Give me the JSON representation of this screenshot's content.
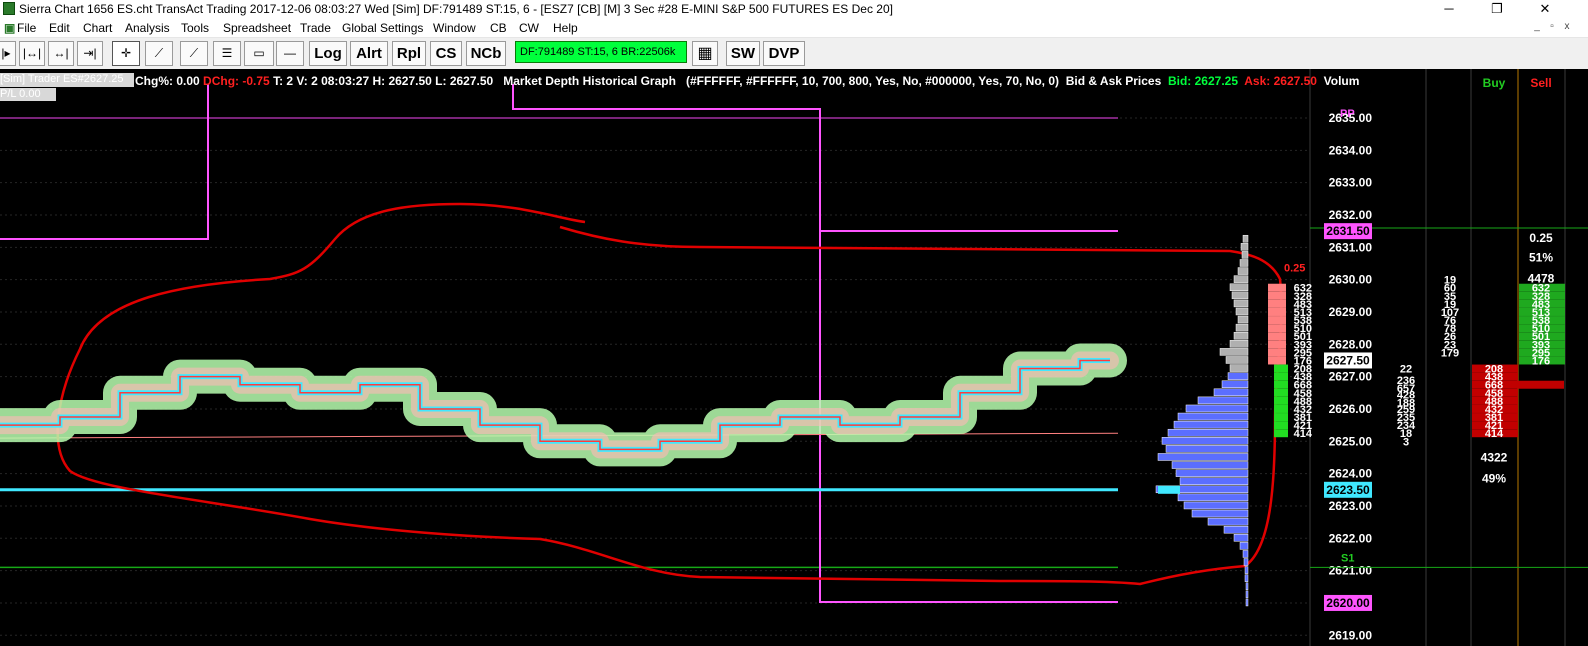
{
  "window": {
    "title": "Sierra Chart 1656 ES.cht  TransAct Trading 2017-12-06  08:03:27 Wed [Sim]  DF:791489  ST:15, 6 - [ESZ7 [CB] [M]  3 Sec   #28  E-MINI S&P 500 FUTURES ES Dec 20]",
    "minimize": "─",
    "restore": "❐",
    "close": "✕"
  },
  "menu": {
    "items": [
      "File",
      "Edit",
      "Chart",
      "Analysis",
      "Tools",
      "Spreadsheet",
      "Trade",
      "Global Settings",
      "Window",
      "CB",
      "CW",
      "Help"
    ],
    "mdi_min": "_",
    "mdi_restore": "▫",
    "mdi_close": "x"
  },
  "toolbar": {
    "icon_glyphs": [
      "|▸",
      "|↔|",
      "↔|",
      "⇥|",
      "✛",
      "⟋",
      "⟋",
      "☰",
      "▭",
      "—"
    ],
    "log": "Log",
    "alrt": "Alrt",
    "rpl": "Rpl",
    "cs": "CS",
    "ncb": "NCb",
    "df_status": "DF:791489  ST:15, 6  BR:22506k",
    "time_icon": "▦",
    "sw": "SW",
    "dvp": "DVP"
  },
  "colors": {
    "pp_line": "#7a247a",
    "s1_line": "#17a817",
    "magenta": "#ff55ff",
    "red_curve": "#e00000",
    "cyan": "#40e8ff",
    "blue_vap": "#5b6eff",
    "buy_green": "#1fa91f",
    "sell_red": "#c10000"
  },
  "info_bar": {
    "sim_label": "[Sim]  Trader  ES#2627.25",
    "pl_label": "P/L 0.00",
    "chg": "Chg%: 0.00",
    "dchg": "DChg: -0.75",
    "stats": "T: 2  V: 2  08:03:27  H: 2627.50  L: 2627.50",
    "mdhg": "Market Depth Historical Graph",
    "params": "(#FFFFFF, #FFFFFF, 10, 700, 800, Yes, No, #000000, Yes, 70, No, 0)",
    "bidask": "Bid & Ask Prices",
    "bid": "Bid: 2627.25",
    "ask": "Ask: 2627.50",
    "volume": "Volum"
  },
  "chart_data": {
    "type": "line",
    "price_axis": {
      "min": 2619.5,
      "max": 2635.5,
      "ticks": [
        "2635.00",
        "2634.00",
        "2633.00",
        "2632.00",
        "2631.00",
        "2630.00",
        "2629.00",
        "2628.00",
        "2627.00",
        "2626.00",
        "2625.00",
        "2624.00",
        "2623.00",
        "2622.00",
        "2621.00",
        "2620.00",
        "2619.00"
      ]
    },
    "levels": [
      {
        "label": "PP",
        "price": 2635.0
      },
      {
        "label": "S1",
        "price": 2621.1
      },
      {
        "label": "2631.50",
        "price": 2631.5
      },
      {
        "label": "2623.50",
        "price": 2623.5
      },
      {
        "label": "2620.00",
        "price": 2620.0
      }
    ],
    "last_price": "2627.50",
    "ask_ladder_value": "0.25",
    "ladder_ask_sizes": [
      "632",
      "328",
      "483",
      "513",
      "538",
      "510",
      "501",
      "393",
      "295",
      "176"
    ],
    "ladder_bid_sizes": [
      "208",
      "438",
      "668",
      "458",
      "488",
      "432",
      "381",
      "421",
      "414"
    ],
    "col_a": [
      {
        "price": 2627.25,
        "v": "22"
      },
      {
        "price": 2626.9,
        "v": "236"
      },
      {
        "price": 2626.65,
        "v": "657"
      },
      {
        "price": 2626.45,
        "v": "428"
      },
      {
        "price": 2626.2,
        "v": "188"
      },
      {
        "price": 2626.0,
        "v": "259"
      },
      {
        "price": 2625.75,
        "v": "235"
      },
      {
        "price": 2625.5,
        "v": "234"
      },
      {
        "price": 2625.25,
        "v": "18"
      },
      {
        "price": 2625.0,
        "v": "3"
      }
    ],
    "col_b": [
      {
        "price": 2630.0,
        "v": "19"
      },
      {
        "price": 2629.75,
        "v": "60"
      },
      {
        "price": 2629.5,
        "v": "35"
      },
      {
        "price": 2629.25,
        "v": "19"
      },
      {
        "price": 2629.0,
        "v": "107"
      },
      {
        "price": 2628.75,
        "v": "76"
      },
      {
        "price": 2628.5,
        "v": "78"
      },
      {
        "price": 2628.25,
        "v": "26"
      },
      {
        "price": 2628.0,
        "v": "23"
      },
      {
        "price": 2627.75,
        "v": "179"
      }
    ],
    "buy_header": "Buy",
    "sell_header": "Sell",
    "sell_tick": "0.25",
    "sell_pct": "51%",
    "sell_total": "4478",
    "buy_total": "4322",
    "buy_pct": "49%",
    "sell_sizes": [
      "632",
      "328",
      "483",
      "513",
      "538",
      "510",
      "501",
      "393",
      "295",
      "176"
    ],
    "buy_sizes": [
      "208",
      "438",
      "668",
      "458",
      "488",
      "432",
      "381",
      "421",
      "414"
    ],
    "series": [
      {
        "x": [
          0,
          60,
          120,
          180,
          240,
          300,
          360,
          420,
          480,
          540,
          600,
          660,
          720,
          780,
          840,
          900,
          960,
          1020,
          1080,
          1110
        ],
        "y": [
          2625.5,
          2625.75,
          2626.5,
          2627.0,
          2626.75,
          2626.5,
          2626.75,
          2626.0,
          2625.5,
          2625.0,
          2624.75,
          2625.0,
          2625.5,
          2625.75,
          2625.5,
          2625.75,
          2626.5,
          2627.25,
          2627.5,
          2627.5
        ]
      }
    ],
    "vap_profile": [
      {
        "price": 2631.25,
        "v": 5
      },
      {
        "price": 2631.0,
        "v": 7
      },
      {
        "price": 2630.75,
        "v": 6
      },
      {
        "price": 2630.5,
        "v": 8
      },
      {
        "price": 2630.25,
        "v": 10
      },
      {
        "price": 2630.0,
        "v": 14
      },
      {
        "price": 2629.75,
        "v": 18
      },
      {
        "price": 2629.5,
        "v": 16
      },
      {
        "price": 2629.25,
        "v": 14
      },
      {
        "price": 2629.0,
        "v": 12
      },
      {
        "price": 2628.75,
        "v": 10
      },
      {
        "price": 2628.5,
        "v": 12
      },
      {
        "price": 2628.25,
        "v": 14
      },
      {
        "price": 2628.0,
        "v": 18
      },
      {
        "price": 2627.75,
        "v": 28
      },
      {
        "price": 2627.5,
        "v": 22
      },
      {
        "price": 2627.25,
        "v": 18
      },
      {
        "price": 2627.0,
        "v": 20
      },
      {
        "price": 2626.75,
        "v": 26
      },
      {
        "price": 2626.5,
        "v": 34
      },
      {
        "price": 2626.25,
        "v": 50
      },
      {
        "price": 2626.0,
        "v": 62
      },
      {
        "price": 2625.75,
        "v": 70
      },
      {
        "price": 2625.5,
        "v": 74
      },
      {
        "price": 2625.25,
        "v": 80
      },
      {
        "price": 2625.0,
        "v": 86
      },
      {
        "price": 2624.75,
        "v": 82
      },
      {
        "price": 2624.5,
        "v": 90
      },
      {
        "price": 2624.25,
        "v": 76
      },
      {
        "price": 2624.0,
        "v": 72
      },
      {
        "price": 2623.75,
        "v": 68
      },
      {
        "price": 2623.5,
        "v": 92
      },
      {
        "price": 2623.25,
        "v": 70
      },
      {
        "price": 2623.0,
        "v": 64
      },
      {
        "price": 2622.75,
        "v": 56
      },
      {
        "price": 2622.5,
        "v": 40
      },
      {
        "price": 2622.25,
        "v": 24
      },
      {
        "price": 2622.0,
        "v": 14
      },
      {
        "price": 2621.75,
        "v": 8
      },
      {
        "price": 2621.5,
        "v": 5
      },
      {
        "price": 2621.25,
        "v": 4
      },
      {
        "price": 2621.0,
        "v": 3
      },
      {
        "price": 2620.75,
        "v": 3
      },
      {
        "price": 2620.5,
        "v": 2
      },
      {
        "price": 2620.25,
        "v": 2
      },
      {
        "price": 2620.0,
        "v": 2
      }
    ]
  }
}
